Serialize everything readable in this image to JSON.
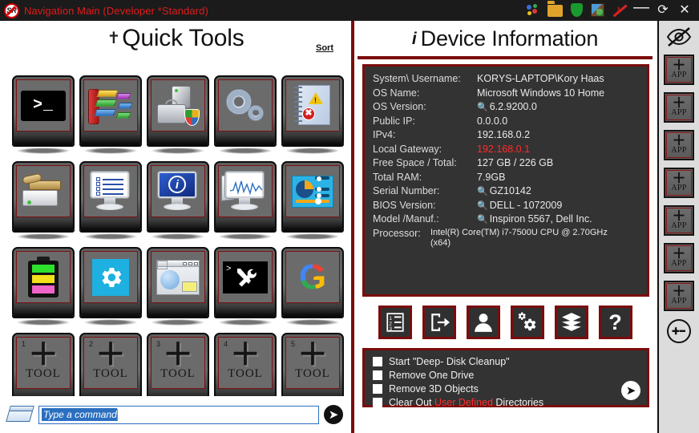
{
  "window": {
    "title": "Navigation Main (Developer *Standard)",
    "logo_text": "SR",
    "titlebar_icons": [
      {
        "name": "colored-dots-icon",
        "label": "dots"
      },
      {
        "name": "folder-icon",
        "label": "folder"
      },
      {
        "name": "shield-icon",
        "label": "shield"
      },
      {
        "name": "block-icon",
        "label": "block"
      },
      {
        "name": "mute-music-icon",
        "label": "mute"
      }
    ],
    "minimize_label": "—",
    "refresh_label": "⟳",
    "close_label": "✕",
    "accent_red": "#7b0c0c",
    "title_red": "#e21b1b",
    "alert_red": "#ff2b2b",
    "panel_dark": "#333333"
  },
  "quick_tools": {
    "title": "Quick Tools",
    "wrench_icon": "hammer-wrench-icon",
    "sort_label": "Sort",
    "tiles": [
      {
        "name": "command-prompt",
        "icon": "command-prompt-icon",
        "text": ">_"
      },
      {
        "name": "disk-defragmenter",
        "icon": "defragment-icon",
        "text": ""
      },
      {
        "name": "system-security",
        "icon": "system-tower-shield-icon",
        "text": ""
      },
      {
        "name": "services",
        "icon": "gears-icon",
        "text": ""
      },
      {
        "name": "event-viewer",
        "icon": "event-log-warning-icon",
        "text": ""
      },
      {
        "name": "disk-cleanup",
        "icon": "disk-brush-icon",
        "text": ""
      },
      {
        "name": "task-list",
        "icon": "monitor-checklist-icon",
        "text": ""
      },
      {
        "name": "system-information",
        "icon": "monitor-info-icon",
        "text": ""
      },
      {
        "name": "performance-monitor",
        "icon": "monitor-graph-icon",
        "text": ""
      },
      {
        "name": "resource-dashboard",
        "icon": "dashboard-pie-icon",
        "text": ""
      },
      {
        "name": "battery-report",
        "icon": "battery-icon",
        "text": ""
      },
      {
        "name": "windows-settings",
        "icon": "blue-gear-icon",
        "text": ""
      },
      {
        "name": "display-panel",
        "icon": "window-panel-icon",
        "text": ""
      },
      {
        "name": "powershell-tools",
        "icon": "terminal-tools-icon",
        "text": ""
      },
      {
        "name": "google-search",
        "icon": "google-g-icon",
        "text": "G"
      }
    ],
    "empty_slots": [
      {
        "number": "1",
        "label": "TOOL",
        "plus": "＋"
      },
      {
        "number": "2",
        "label": "TOOL",
        "plus": "＋"
      },
      {
        "number": "3",
        "label": "TOOL",
        "plus": "＋"
      },
      {
        "number": "4",
        "label": "TOOL",
        "plus": "＋"
      },
      {
        "number": "5",
        "label": "TOOL",
        "plus": "＋"
      }
    ]
  },
  "command_bar": {
    "icon": "window-command-icon",
    "value": "Type a command",
    "placeholder": "Type a command",
    "submit_label": "➤"
  },
  "device_information": {
    "title": "Device Information",
    "info_icon": "info-italic-i-icon",
    "rows": [
      {
        "label": "System\\ Username:",
        "value": "KORYS-LAPTOP\\Kory Haas",
        "search": false,
        "red": false
      },
      {
        "label": "OS Name:",
        "value": "Microsoft Windows 10 Home",
        "search": false,
        "red": false
      },
      {
        "label": "OS Version:",
        "value": "6.2.9200.0",
        "search": true,
        "red": false
      },
      {
        "label": "Public IP:",
        "value": "0.0.0.0",
        "search": false,
        "red": false
      },
      {
        "label": "IPv4:",
        "value": "192.168.0.2",
        "search": false,
        "red": false
      },
      {
        "label": "Local Gateway:",
        "value": "192.168.0.1",
        "search": false,
        "red": true
      },
      {
        "label": "Free Space / Total:",
        "value": "127 GB / 226 GB",
        "search": false,
        "red": false
      },
      {
        "label": "Total RAM:",
        "value": "7.9GB",
        "search": false,
        "red": false
      },
      {
        "label": "Serial Number:",
        "value": "GZ10142",
        "search": true,
        "red": false
      },
      {
        "label": "BIOS Version:",
        "value": "DELL   - 1072009",
        "search": true,
        "red": false
      },
      {
        "label": "Model /Manuf.:",
        "value": "Inspiron 5567, Dell Inc.",
        "search": true,
        "red": false
      }
    ],
    "processor_label": "Processor:",
    "processor_value": "Intel(R) Core(TM) i7-7500U CPU @ 2.70GHz (x64)"
  },
  "action_icons": [
    {
      "name": "numbered-list-icon",
      "label": "Task List"
    },
    {
      "name": "logout-door-icon",
      "label": "Exit"
    },
    {
      "name": "user-profile-icon",
      "label": "User"
    },
    {
      "name": "gears-settings-icon",
      "label": "Settings"
    },
    {
      "name": "database-stack-icon",
      "label": "Database"
    },
    {
      "name": "help-question-icon",
      "label": "?"
    }
  ],
  "cleanup_options": {
    "items": [
      {
        "label": "Start \"Deep- Disk Cleanup\"",
        "checked": false,
        "red_part": "",
        "tail": ""
      },
      {
        "label": "Remove One Drive",
        "checked": false,
        "red_part": "",
        "tail": ""
      },
      {
        "label": "Remove 3D Objects",
        "checked": false,
        "red_part": "",
        "tail": ""
      },
      {
        "label": "Clear Out ",
        "checked": false,
        "red_part": "User Defined",
        "tail": " Directories"
      }
    ],
    "run_label": "➤"
  },
  "sidebar": {
    "hide_icon": "eye-slash-icon",
    "app_slots": [
      {
        "plus": "＋",
        "label": "APP"
      },
      {
        "plus": "＋",
        "label": "APP"
      },
      {
        "plus": "＋",
        "label": "APP"
      },
      {
        "plus": "＋",
        "label": "APP"
      },
      {
        "plus": "＋",
        "label": "APP"
      },
      {
        "plus": "＋",
        "label": "APP"
      },
      {
        "plus": "＋",
        "label": "APP"
      }
    ],
    "resize_label": "✚➖",
    "resize_icon": "plus-minus-circle-icon"
  }
}
